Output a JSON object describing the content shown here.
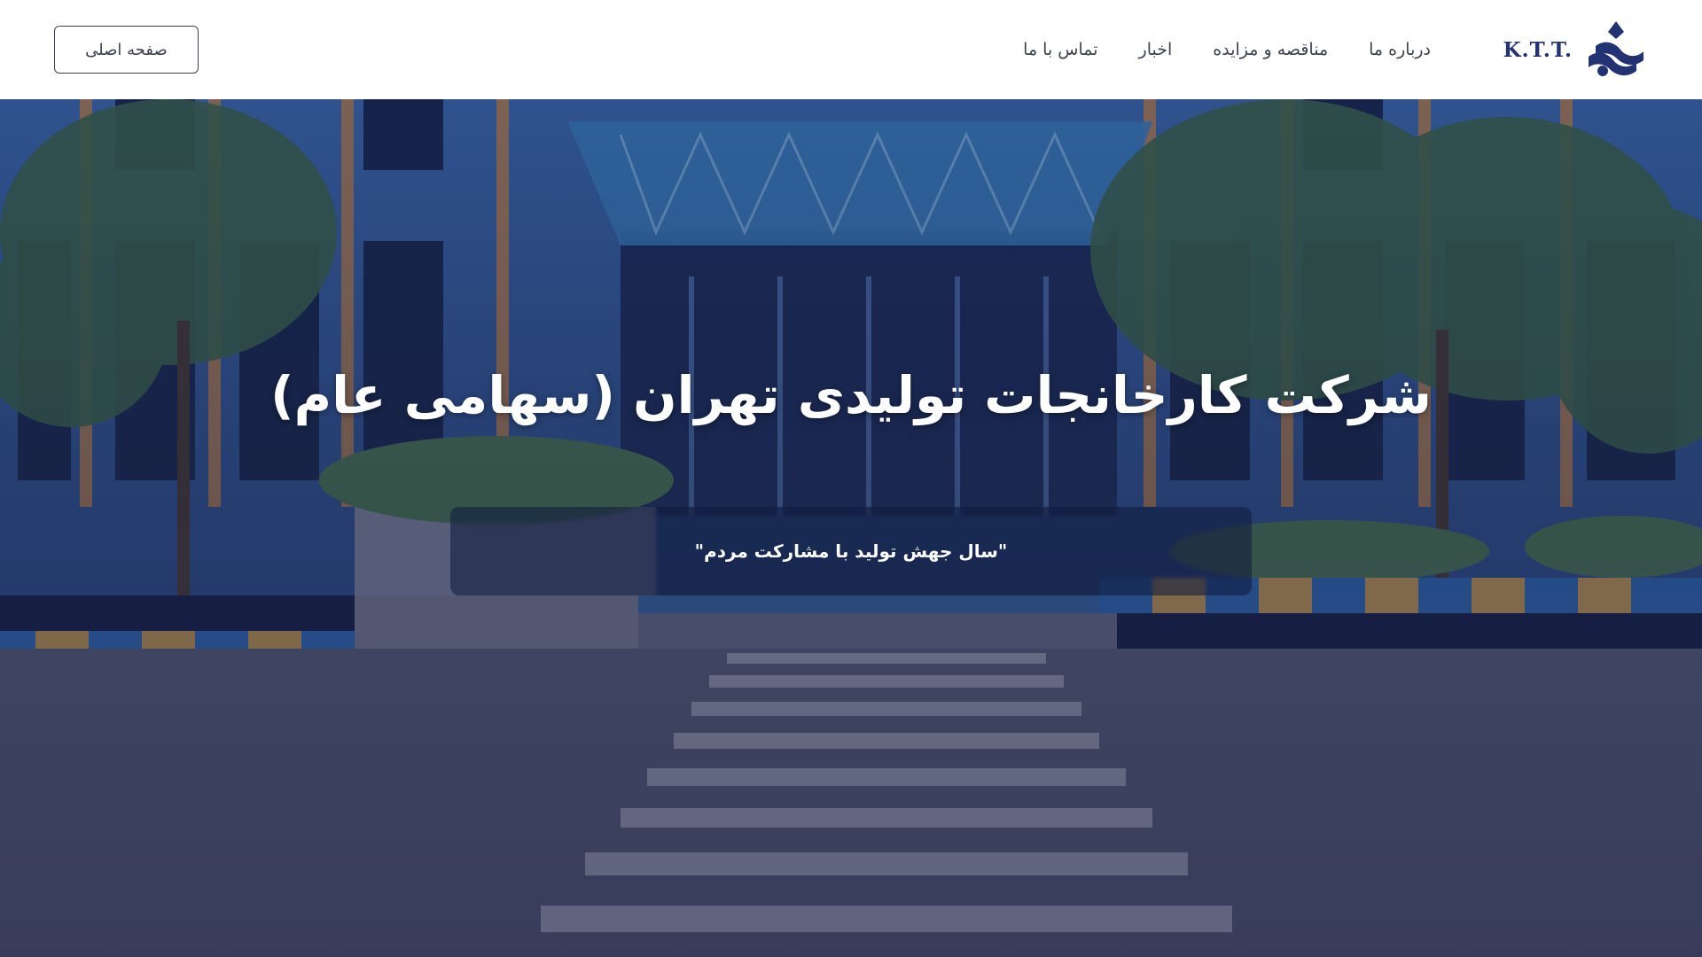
{
  "header": {
    "logo_text": "K.T.T.",
    "nav": [
      "درباره ما",
      "مناقصه و مزایده",
      "اخبار",
      "تماس با ما"
    ],
    "home_button": "صفحه اصلی"
  },
  "hero": {
    "title": "شرکت کارخانجات تولیدی تهران (سهامی عام)",
    "motto": "\"سال جهش تولید با مشارکت مردم\""
  },
  "colors": {
    "brand": "#233272",
    "header_bg": "#ffffff",
    "hero_overlay": "#141e50"
  }
}
